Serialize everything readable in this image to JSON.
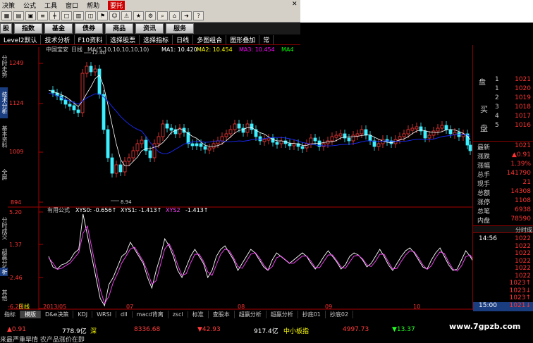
{
  "menu": {
    "items": [
      "决策",
      "公式",
      "工具",
      "窗口",
      "帮助"
    ],
    "highlight": "要托",
    "close_symbol": "✕"
  },
  "funcbar": [
    "股",
    "指数",
    "基金",
    "债券",
    "商品",
    "资讯",
    "服务"
  ],
  "tabs": [
    "Level2默认",
    "技术分析",
    "F10资料",
    "选择股票",
    "选择指标",
    "日线",
    "多图组合",
    "图形叠加",
    "常"
  ],
  "left_tabs": [
    "分时走势",
    "技术分析",
    "基本资料",
    "全屏",
    "分时成交",
    "超赢分析",
    "析",
    "其他"
  ],
  "main_chart": {
    "stock_name": "中国宝安",
    "period": "日线",
    "ma_label": "MA(5,10,10,10,10,10)",
    "ma1": "MA1: 10.420",
    "ma2": "MA2: 10.454",
    "ma3": "MA3: 10.454",
    "ma4": "MA4",
    "y_ticks": [
      "1249",
      "1124",
      "1009",
      "894"
    ],
    "high_label": "12.40",
    "low_label": "8.94"
  },
  "sub_chart": {
    "name": "有用公式",
    "xys0": "XYS0: -0.656↑",
    "xys1": "XYS1: -1.413↑",
    "xys2": "XYS2",
    "xys2_val": "-1.413↑",
    "y_ticks": [
      "5.20",
      "1.37",
      "-2.46",
      "-6.29"
    ]
  },
  "x_axis": [
    "日线",
    "2013/05",
    "07",
    "08",
    "09",
    "10"
  ],
  "bottom_tabs": [
    "指标",
    "模版",
    "D&e决策",
    "KDJ",
    "WRSI",
    "dll",
    "macd背离",
    "zscl",
    "标准",
    "查股本",
    "超赢分析",
    "超赢分析",
    "抄底01",
    "抄底02"
  ],
  "right_panel": {
    "sell_head": "盘",
    "sell": [
      {
        "idx": "1",
        "val": "1021"
      },
      {
        "idx": "1",
        "val": "1020"
      },
      {
        "idx": "2",
        "val": "1019"
      },
      {
        "idx": "3",
        "val": "1018"
      },
      {
        "idx": "4",
        "val": "1017"
      },
      {
        "idx": "5",
        "val": "1016"
      }
    ],
    "buy_label_1": "买",
    "buy_label_2": "盘",
    "stats": [
      {
        "label": "最新",
        "val": "1021"
      },
      {
        "label": "涨跌",
        "val": "▲0.91"
      },
      {
        "label": "涨幅",
        "val": "1.39%"
      },
      {
        "label": "总手",
        "val": "141790"
      },
      {
        "label": "现手",
        "val": "21"
      },
      {
        "label": "总额",
        "val": "14308"
      },
      {
        "label": "涨停",
        "val": "1108"
      },
      {
        "label": "总笔",
        "val": "6938"
      },
      {
        "label": "内盘",
        "val": "78590"
      }
    ],
    "fenshi_title": "分时成",
    "ticks": [
      {
        "time": "14:56",
        "price": "1022",
        "vol": "1022"
      },
      {
        "time": "",
        "price": "",
        "vol": "1022"
      },
      {
        "time": "",
        "price": "",
        "vol": "1022"
      },
      {
        "time": "",
        "price": "",
        "vol": "1022"
      },
      {
        "time": "",
        "price": "",
        "vol": "1022"
      },
      {
        "time": "",
        "price": "",
        "vol": "1022"
      },
      {
        "time": "",
        "price": "",
        "vol": "1023↑"
      },
      {
        "time": "",
        "price": "",
        "vol": "1023↓"
      },
      {
        "time": "",
        "price": "",
        "vol": "1023↑"
      },
      {
        "time": "15:00",
        "price": "",
        "vol": "1021↓"
      }
    ]
  },
  "ticker1": {
    "a": "▲0.91",
    "b_val": "778.9亿",
    "b_label": "深",
    "c": "8336.68",
    "d": "▼42.93",
    "e_val": "917.4亿",
    "e_label": "中小板指",
    "f": "4997.73",
    "g": "▼13.37"
  },
  "ticker2": "来最严重旱情 农产品涨价在即",
  "watermark": "www.7gpzb.com",
  "colors": {
    "up": "#ff3b3b",
    "down": "#3cf0ff",
    "ma": "#ffffff",
    "ma2": "#1a2bff",
    "xys1": "#ffffff",
    "xys2": "#ff44ff"
  }
}
